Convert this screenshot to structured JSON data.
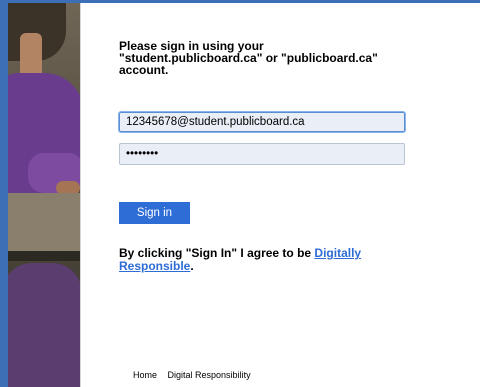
{
  "prompt": {
    "heading": "Please sign in using your\n\"student.publicboard.ca\" or \"publicboard.ca\"\naccount."
  },
  "login": {
    "email_value": "12345678@student.publicboard.ca",
    "password_value": "••••••••",
    "signin_label": "Sign in"
  },
  "agreement": {
    "prefix": "By clicking \"Sign In\" I agree to be ",
    "link_text": "Digitally Responsible",
    "suffix": "."
  },
  "footer": {
    "links": [
      "Home",
      "Digital Responsibility"
    ]
  },
  "colors": {
    "accent": "#2e6cd6",
    "frame": "#3d6fb6",
    "input_bg": "#e9eef7"
  }
}
